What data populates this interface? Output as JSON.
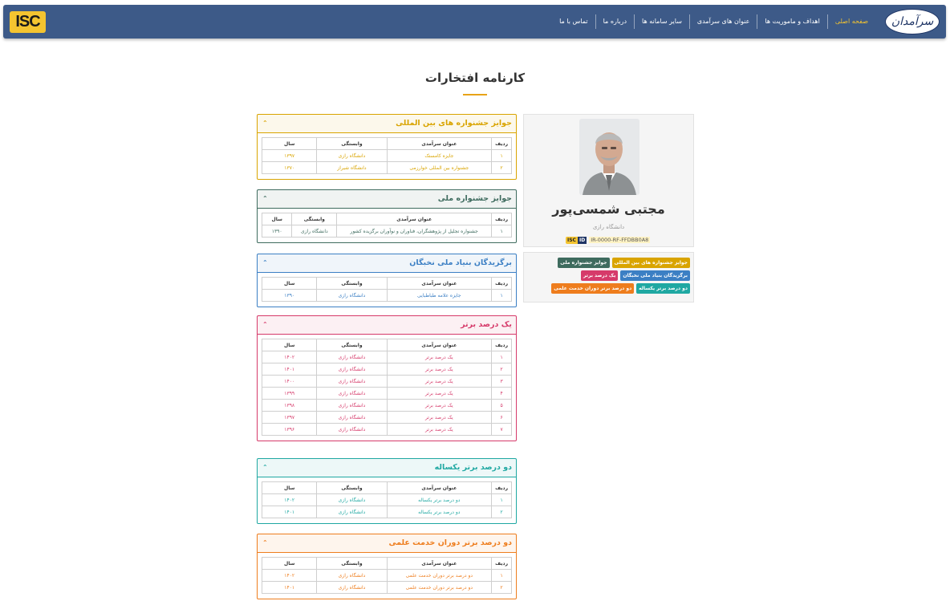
{
  "nav": {
    "brand": "سرآمدان",
    "isc_logo": "ISC",
    "items": [
      {
        "label": "صفحه اصلی",
        "active": true
      },
      {
        "label": "اهداف و ماموریت ها"
      },
      {
        "label": "عنوان های سرآمدی"
      },
      {
        "label": "سایر سامانه ها"
      },
      {
        "label": "درباره ما"
      },
      {
        "label": "تماس با ما"
      }
    ]
  },
  "page": {
    "title": "کارنامه افتخارات"
  },
  "profile": {
    "name": "مجتبی شمسی‌پور",
    "university": "دانشگاه رازی",
    "isc_label": "ISC",
    "id_label": "ID",
    "id": "IR-0000-RF-FFDBB0A8"
  },
  "tags": [
    {
      "label": "جوایز جشنواره های بین المللی",
      "color": "#d9a400"
    },
    {
      "label": "جوایز جشنواره ملی",
      "color": "#3e6b5e"
    },
    {
      "label": "برگزیدگان بنیاد ملی نخبگان",
      "color": "#3b7fc4"
    },
    {
      "label": "یک درصد برتر",
      "color": "#d63a6a"
    },
    {
      "label": "دو درصد برتر یکساله",
      "color": "#1fa8a2"
    },
    {
      "label": "دو درصد برتر دوران خدمت علمی",
      "color": "#ee7d1d"
    }
  ],
  "table_headers": {
    "row": "ردیف",
    "title": "عنوان سرآمدی",
    "affiliation": "وابستگی",
    "year": "سال"
  },
  "sections": [
    {
      "title": "جوایز جشنواره های بین المللی",
      "color": "#d9a400",
      "rows": [
        {
          "n": "۱",
          "title": "جایزه کامستک",
          "aff": "دانشگاه رازی",
          "year": "۱۳۹۷"
        },
        {
          "n": "۲",
          "title": "جشنواره بین المللی خوارزمی",
          "aff": "دانشگاه شیراز",
          "year": "۱۳۷۰"
        }
      ]
    },
    {
      "title": "جوایز جشنواره ملی",
      "color": "#3e6b5e",
      "rows": [
        {
          "n": "۱",
          "title": "جشنواره تجلیل از پژوهشگران، فناوران و نوآوران برگزیده کشور",
          "aff": "دانشگاه رازی",
          "year": "۱۳۹۰"
        }
      ]
    },
    {
      "title": "برگزیدگان بنیاد ملی نخبگان",
      "color": "#3b7fc4",
      "rows": [
        {
          "n": "۱",
          "title": "جایزه علامه طباطبایی",
          "aff": "دانشگاه رازی",
          "year": "۱۳۹۰"
        }
      ]
    },
    {
      "title": "یک درصد برتر",
      "color": "#d63a6a",
      "rows": [
        {
          "n": "۱",
          "title": "یک درصد برتر",
          "aff": "دانشگاه رازی",
          "year": "۱۴۰۲"
        },
        {
          "n": "۲",
          "title": "یک درصد برتر",
          "aff": "دانشگاه رازی",
          "year": "۱۴۰۱"
        },
        {
          "n": "۳",
          "title": "یک درصد برتر",
          "aff": "دانشگاه رازی",
          "year": "۱۴۰۰"
        },
        {
          "n": "۴",
          "title": "یک درصد برتر",
          "aff": "دانشگاه رازی",
          "year": "۱۳۹۹"
        },
        {
          "n": "۵",
          "title": "یک درصد برتر",
          "aff": "دانشگاه رازی",
          "year": "۱۳۹۸"
        },
        {
          "n": "۶",
          "title": "یک درصد برتر",
          "aff": "دانشگاه رازی",
          "year": "۱۳۹۷"
        },
        {
          "n": "۷",
          "title": "یک درصد برتر",
          "aff": "دانشگاه رازی",
          "year": "۱۳۹۶"
        }
      ]
    },
    {
      "title": "دو درصد برتر یکساله",
      "color": "#1fa8a2",
      "rows": [
        {
          "n": "۱",
          "title": "دو درصد برتر یکساله",
          "aff": "دانشگاه رازی",
          "year": "۱۴۰۲"
        },
        {
          "n": "۲",
          "title": "دو درصد برتر یکساله",
          "aff": "دانشگاه رازی",
          "year": "۱۴۰۱"
        }
      ]
    },
    {
      "title": "دو درصد برتر دوران خدمت علمی",
      "color": "#ee7d1d",
      "rows": [
        {
          "n": "۱",
          "title": "دو درصد برتر دوران خدمت علمی",
          "aff": "دانشگاه رازی",
          "year": "۱۴۰۲"
        },
        {
          "n": "۲",
          "title": "دو درصد برتر دوران خدمت علمی",
          "aff": "دانشگاه رازی",
          "year": "۱۴۰۱"
        }
      ]
    }
  ]
}
